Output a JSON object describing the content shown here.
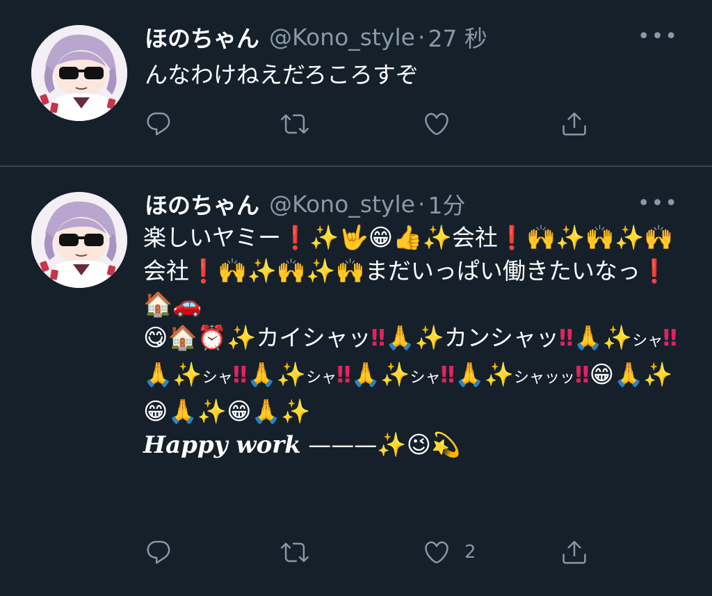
{
  "tweets": [
    {
      "name": "ほのちゃん",
      "handle": "@Kono_style",
      "separator": "·",
      "time": "27 秒",
      "more": "•••",
      "text": "んなわけねえだろころすぞ",
      "like_count": ""
    },
    {
      "name": "ほのちゃん",
      "handle": "@Kono_style",
      "separator": "·",
      "time": "1分",
      "more": "•••",
      "segments": {
        "s1": "楽しいヤミー",
        "s2": "会社",
        "s3": "会社",
        "s4": "まだいっぱい働きたいなっ",
        "s5": "カイシャッ",
        "s6": "カンシャッ",
        "s7": "シャ",
        "s8": "シャ",
        "s9": "シャ",
        "s10": "シャ",
        "s11": "シャッッ",
        "happy": "Happy work",
        "dash": "———"
      },
      "like_count": "2"
    }
  ],
  "icons": [
    "avatar",
    "more-icon",
    "reply-icon",
    "retweet-icon",
    "like-icon",
    "share-icon"
  ],
  "colors": {
    "background": "#15202b",
    "text": "#ffffff",
    "secondary": "#8899a6",
    "divider": "#38444d"
  }
}
